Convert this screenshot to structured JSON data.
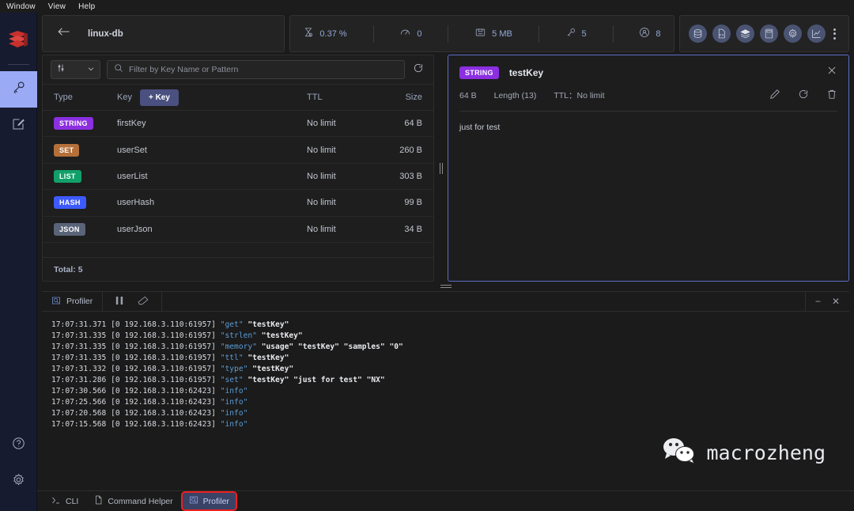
{
  "menubar": {
    "items": [
      "Window",
      "View",
      "Help"
    ]
  },
  "rail": {
    "logo": "redis-logo",
    "items": [
      {
        "name": "browser",
        "icon": "key-icon",
        "active": true
      },
      {
        "name": "workbench",
        "icon": "edit-square-icon",
        "active": false
      }
    ],
    "bottom": [
      {
        "name": "help",
        "icon": "question-circle-icon"
      },
      {
        "name": "settings",
        "icon": "gear-icon"
      }
    ]
  },
  "topbar": {
    "back_icon": "arrow-left-icon",
    "db_name": "linux-db",
    "stats": [
      {
        "icon": "cpu-icon",
        "label": "cpu",
        "value": "0.37 %"
      },
      {
        "icon": "gauge-icon",
        "label": "ops",
        "value": "0"
      },
      {
        "icon": "memory-icon",
        "label": "memory",
        "value": "5 MB"
      },
      {
        "icon": "key-icon",
        "label": "keys",
        "value": "5"
      },
      {
        "icon": "user-icon",
        "label": "clients",
        "value": "8"
      }
    ],
    "icon_buttons": [
      {
        "name": "database-icon"
      },
      {
        "name": "file-code-icon"
      },
      {
        "name": "layers-icon"
      },
      {
        "name": "calculator-icon"
      },
      {
        "name": "gear-icon"
      },
      {
        "name": "chart-line-icon"
      }
    ],
    "kebab": "more-vertical-icon"
  },
  "filter": {
    "type_select_value": "",
    "type_select_icon": "sliders-icon",
    "chevron": "chevron-down-icon",
    "search_icon": "search-icon",
    "placeholder": "Filter by Key Name or Pattern",
    "value": "",
    "refresh_icon": "refresh-icon"
  },
  "table": {
    "columns": [
      "Type",
      "Key",
      "TTL",
      "Size"
    ],
    "add_key_label": "+ Key",
    "rows": [
      {
        "type": "STRING",
        "color": "#8b2fe0",
        "key": "firstKey",
        "ttl": "No limit",
        "size": "64 B"
      },
      {
        "type": "SET",
        "color": "#b5703a",
        "key": "userSet",
        "ttl": "No limit",
        "size": "260 B"
      },
      {
        "type": "LIST",
        "color": "#12a06a",
        "key": "userList",
        "ttl": "No limit",
        "size": "303 B"
      },
      {
        "type": "HASH",
        "color": "#3d5afe",
        "key": "userHash",
        "ttl": "No limit",
        "size": "99 B"
      },
      {
        "type": "JSON",
        "color": "#5a6478",
        "key": "userJson",
        "ttl": "No limit",
        "size": "34 B"
      }
    ],
    "total_label": "Total: 5"
  },
  "detail": {
    "type": "STRING",
    "type_color": "#8b2fe0",
    "key_name": "testKey",
    "size": "64 B",
    "length": "Length (13)",
    "ttl": "TTL：No limit",
    "value": "just for test",
    "actions": [
      {
        "name": "edit-icon"
      },
      {
        "name": "refresh-icon"
      },
      {
        "name": "delete-icon"
      }
    ],
    "close_icon": "close-icon",
    "border_color": "#5b6ec8"
  },
  "profiler": {
    "title": "Profiler",
    "title_icon": "profiler-icon",
    "tools": [
      {
        "name": "pause-icon",
        "glyph": "❙❙"
      },
      {
        "name": "eraser-icon",
        "glyph": "eraser"
      }
    ],
    "window_buttons": [
      {
        "name": "minimize-icon",
        "glyph": "−"
      },
      {
        "name": "close-icon",
        "glyph": "✕"
      }
    ],
    "log": [
      {
        "ts": "17:07:15.568 [0 192.168.3.110:62423]",
        "cmd": "\"info\"",
        "args": ""
      },
      {
        "ts": "17:07:20.568 [0 192.168.3.110:62423]",
        "cmd": "\"info\"",
        "args": ""
      },
      {
        "ts": "17:07:25.566 [0 192.168.3.110:62423]",
        "cmd": "\"info\"",
        "args": ""
      },
      {
        "ts": "17:07:30.566 [0 192.168.3.110:62423]",
        "cmd": "\"info\"",
        "args": ""
      },
      {
        "ts": "17:07:31.286 [0 192.168.3.110:61957]",
        "cmd": "\"set\"",
        "args": "\"testKey\" \"just for test\" \"NX\""
      },
      {
        "ts": "17:07:31.332 [0 192.168.3.110:61957]",
        "cmd": "\"type\"",
        "args": "\"testKey\""
      },
      {
        "ts": "17:07:31.335 [0 192.168.3.110:61957]",
        "cmd": "\"ttl\"",
        "args": "\"testKey\""
      },
      {
        "ts": "17:07:31.335 [0 192.168.3.110:61957]",
        "cmd": "\"memory\"",
        "args": "\"usage\" \"testKey\" \"samples\" \"0\""
      },
      {
        "ts": "17:07:31.335 [0 192.168.3.110:61957]",
        "cmd": "\"strlen\"",
        "args": "\"testKey\""
      },
      {
        "ts": "17:07:31.371 [0 192.168.3.110:61957]",
        "cmd": "\"get\"",
        "args": "\"testKey\""
      }
    ]
  },
  "watermark": {
    "text": "macrozheng",
    "icon": "wechat-icon"
  },
  "tabbar": {
    "tabs": [
      {
        "label": "CLI",
        "icon": "terminal-icon",
        "active": false,
        "highlight": false
      },
      {
        "label": "Command Helper",
        "icon": "document-icon",
        "active": false,
        "highlight": false
      },
      {
        "label": "Profiler",
        "icon": "profiler-icon",
        "active": true,
        "highlight": true
      }
    ]
  }
}
